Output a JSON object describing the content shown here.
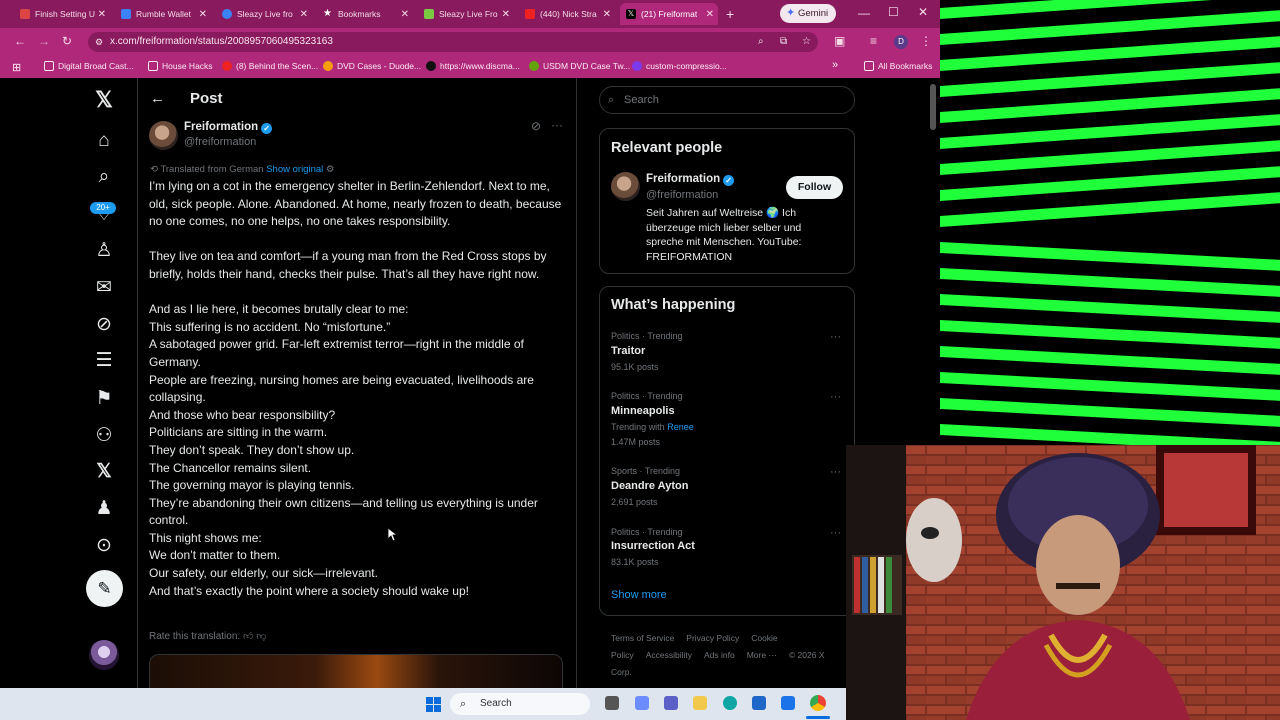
{
  "browser": {
    "tabs": [
      {
        "label": "Finish Setting U",
        "color": "#d44"
      },
      {
        "label": "Rumble Wallet",
        "color": "#3b82f6"
      },
      {
        "label": "Sleazy Live fro",
        "color": "#3b82f6"
      },
      {
        "label": "Bookmarks",
        "color": "#fff"
      },
      {
        "label": "Sleazy Live Fro",
        "color": "#7ac943"
      },
      {
        "label": "(440) Nick Stra",
        "color": "#e22"
      },
      {
        "label": "(21) Freiformat",
        "color": "#000"
      }
    ],
    "new_tab": "+",
    "gemini_label": "Gemini",
    "url": "x.com/freiformation/status/2008957060495323163",
    "profile_initial": "D",
    "bookmarks": [
      "Digital Broad Cast...",
      "House Hacks",
      "(8) Behind the Scen...",
      "DVD Cases - Duode...",
      "https://www.discma...",
      "USDM DVD Case Tw...",
      "custom-compressio..."
    ],
    "all_bookmarks": "All Bookmarks"
  },
  "nav": {
    "notification_badge": "20+"
  },
  "post": {
    "header_title": "Post",
    "author_name": "Freiformation",
    "author_handle": "@freiformation",
    "translated_from": "Translated from German",
    "show_original": "Show original",
    "lines": [
      "I’m lying on a cot in the emergency shelter in Berlin-Zehlendorf. Next to me, old, sick people. Alone. Abandoned. At home, nearly frozen to death, because no one comes, no one helps, no one takes responsibility.",
      "",
      "They live on tea and comfort—if a young man from the Red Cross stops by briefly, holds their hand, checks their pulse. That’s all they have right now.",
      "",
      "And as I lie here, it becomes brutally clear to me:",
      "This suffering is no accident. No “misfortune.”",
      "A sabotaged power grid. Far-left extremist terror—right in the middle of Germany.",
      "People are freezing, nursing homes are being evacuated, livelihoods are collapsing.",
      "And those who bear responsibility?",
      "Politicians are sitting in the warm.",
      "They don’t speak. They don’t show up.",
      "The Chancellor remains silent.",
      "The governing mayor is playing tennis.",
      "They’re abandoning their own citizens—and telling us everything is under control.",
      "This night shows me:",
      "We don’t matter to them.",
      "Our safety, our elderly, our sick—irrelevant.",
      "And that’s exactly the point where a society should wake up!"
    ],
    "rate_translation": "Rate this translation:"
  },
  "sidebar": {
    "search_placeholder": "Search",
    "relevant_title": "Relevant people",
    "person_name": "Freiformation",
    "person_handle": "@freiformation",
    "person_bio": "Seit Jahren auf Weltreise 🌍 Ich überzeuge mich lieber selber und spreche mit Menschen. YouTube: FREIFORMATION",
    "follow_label": "Follow",
    "happening_title": "What’s happening",
    "trends": [
      {
        "category": "Politics · Trending",
        "name": "Traitor",
        "count": "95.1K posts"
      },
      {
        "category": "Politics · Trending",
        "name": "Minneapolis",
        "with_label": "Trending with",
        "with_link": "Renee",
        "count": "1.47M posts"
      },
      {
        "category": "Sports · Trending",
        "name": "Deandre Ayton",
        "count": "2,691 posts"
      },
      {
        "category": "Politics · Trending",
        "name": "Insurrection Act",
        "count": "83.1K posts"
      }
    ],
    "show_more": "Show more",
    "footer": [
      "Terms of Service",
      "Privacy Policy",
      "Cookie Policy",
      "Accessibility",
      "Ads info",
      "More ···",
      "© 2026 X Corp."
    ]
  },
  "taskbar": {
    "search_label": "Search"
  },
  "colors": {
    "x_blue": "#1d9bf0",
    "tabbar": "#8a1a5e",
    "toolbar": "#b0287a",
    "neon_green": "#1fff3a"
  }
}
